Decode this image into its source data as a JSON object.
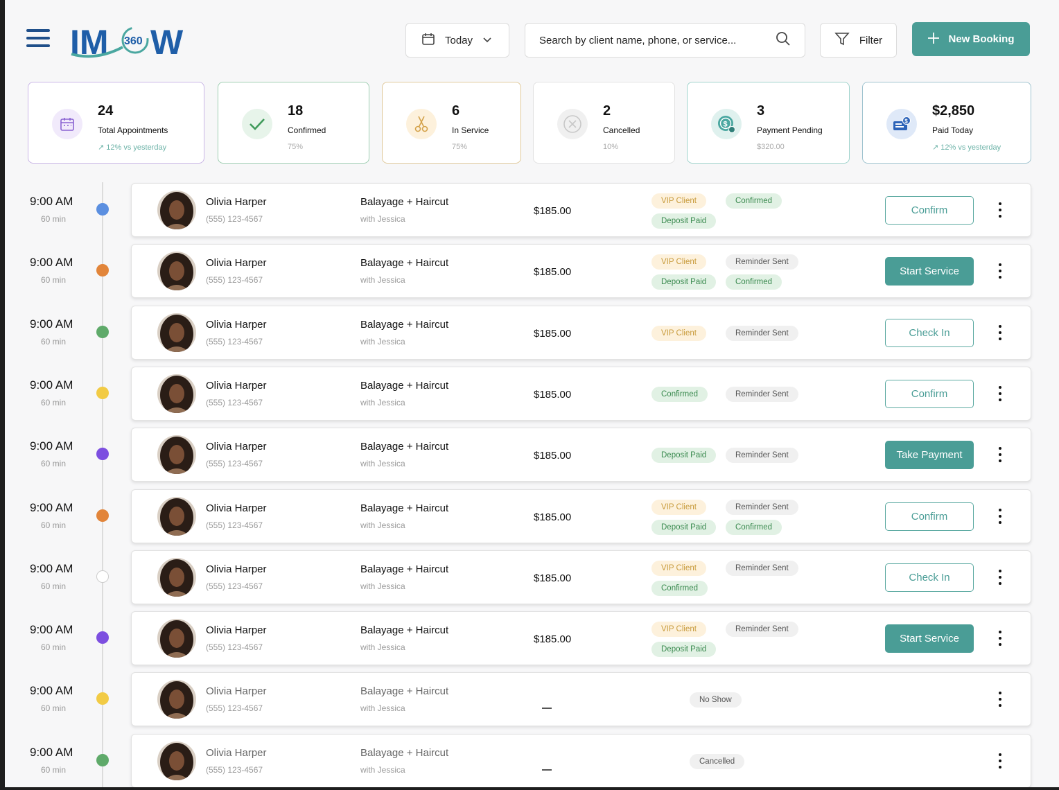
{
  "header": {
    "logo_text": "IMW",
    "logo_badge": "360",
    "date_filter": "Today",
    "search_placeholder": "Search by client name, phone, or service...",
    "filter_label": "Filter",
    "new_booking_label": "New Booking"
  },
  "stats": [
    {
      "value": "24",
      "label": "Total Appointments",
      "sub": "12% vs yesterday",
      "icon": "calendar-icon"
    },
    {
      "value": "18",
      "label": "Confirmed",
      "sub": "75%",
      "icon": "check-icon"
    },
    {
      "value": "6",
      "label": "In Service",
      "sub": "75%",
      "icon": "scissors-icon"
    },
    {
      "value": "2",
      "label": "Cancelled",
      "sub": "10%",
      "icon": "cancel-circle-icon"
    },
    {
      "value": "3",
      "label": "Payment Pending",
      "sub": "$320.00",
      "icon": "money-pending-icon"
    },
    {
      "value": "$2,850",
      "label": "Paid Today",
      "sub": "12% vs yesterday",
      "icon": "cash-icon"
    }
  ],
  "colors": {
    "accent": "#4a9d96",
    "dot_blue": "#5b8fe0",
    "dot_orange": "#e2853a",
    "dot_green": "#5faa6a",
    "dot_yellow": "#f2cb45",
    "dot_purple": "#7d4fe0"
  },
  "appointments": [
    {
      "time": "9:00 AM",
      "duration": "60 min",
      "client": "Olivia Harper",
      "phone": "(555) 123-4567",
      "service": "Balayage + Haircut",
      "stylist": "with Jessica",
      "price": "$185.00",
      "badges": [
        "VIP Client",
        "Confirmed",
        "Deposit Paid"
      ],
      "action": "Confirm"
    },
    {
      "time": "9:00 AM",
      "duration": "60 min",
      "client": "Olivia Harper",
      "phone": "(555) 123-4567",
      "service": "Balayage + Haircut",
      "stylist": "with Jessica",
      "price": "$185.00",
      "badges": [
        "VIP Client",
        "Reminder Sent",
        "Deposit Paid",
        "Confirmed"
      ],
      "action": "Start Service"
    },
    {
      "time": "9:00 AM",
      "duration": "60 min",
      "client": "Olivia Harper",
      "phone": "(555) 123-4567",
      "service": "Balayage + Haircut",
      "stylist": "with Jessica",
      "price": "$185.00",
      "badges": [
        "VIP Client",
        "Reminder Sent"
      ],
      "action": "Check In"
    },
    {
      "time": "9:00 AM",
      "duration": "60 min",
      "client": "Olivia Harper",
      "phone": "(555) 123-4567",
      "service": "Balayage + Haircut",
      "stylist": "with Jessica",
      "price": "$185.00",
      "badges": [
        "Confirmed",
        "Reminder Sent"
      ],
      "action": "Confirm"
    },
    {
      "time": "9:00 AM",
      "duration": "60 min",
      "client": "Olivia Harper",
      "phone": "(555) 123-4567",
      "service": "Balayage + Haircut",
      "stylist": "with Jessica",
      "price": "$185.00",
      "badges": [
        "Deposit Paid",
        "Reminder Sent"
      ],
      "action": "Take Payment"
    },
    {
      "time": "9:00 AM",
      "duration": "60 min",
      "client": "Olivia Harper",
      "phone": "(555) 123-4567",
      "service": "Balayage + Haircut",
      "stylist": "with Jessica",
      "price": "$185.00",
      "badges": [
        "VIP Client",
        "Reminder Sent",
        "Deposit Paid",
        "Confirmed"
      ],
      "action": "Confirm"
    },
    {
      "time": "9:00 AM",
      "duration": "60 min",
      "client": "Olivia Harper",
      "phone": "(555) 123-4567",
      "service": "Balayage + Haircut",
      "stylist": "with Jessica",
      "price": "$185.00",
      "badges": [
        "VIP Client",
        "Reminder Sent",
        "Confirmed"
      ],
      "action": "Check In"
    },
    {
      "time": "9:00 AM",
      "duration": "60 min",
      "client": "Olivia Harper",
      "phone": "(555) 123-4567",
      "service": "Balayage + Haircut",
      "stylist": "with Jessica",
      "price": "$185.00",
      "badges": [
        "VIP Client",
        "Reminder Sent",
        "Deposit Paid"
      ],
      "action": "Start Service"
    },
    {
      "time": "9:00 AM",
      "duration": "60 min",
      "client": "Olivia Harper",
      "phone": "(555) 123-4567",
      "service": "Balayage + Haircut",
      "stylist": "with Jessica",
      "price": "",
      "badges": [
        "No Show"
      ],
      "action": ""
    },
    {
      "time": "9:00 AM",
      "duration": "60 min",
      "client": "Olivia Harper",
      "phone": "(555) 123-4567",
      "service": "Balayage + Haircut",
      "stylist": "with Jessica",
      "price": "",
      "badges": [
        "Cancelled"
      ],
      "action": ""
    }
  ]
}
